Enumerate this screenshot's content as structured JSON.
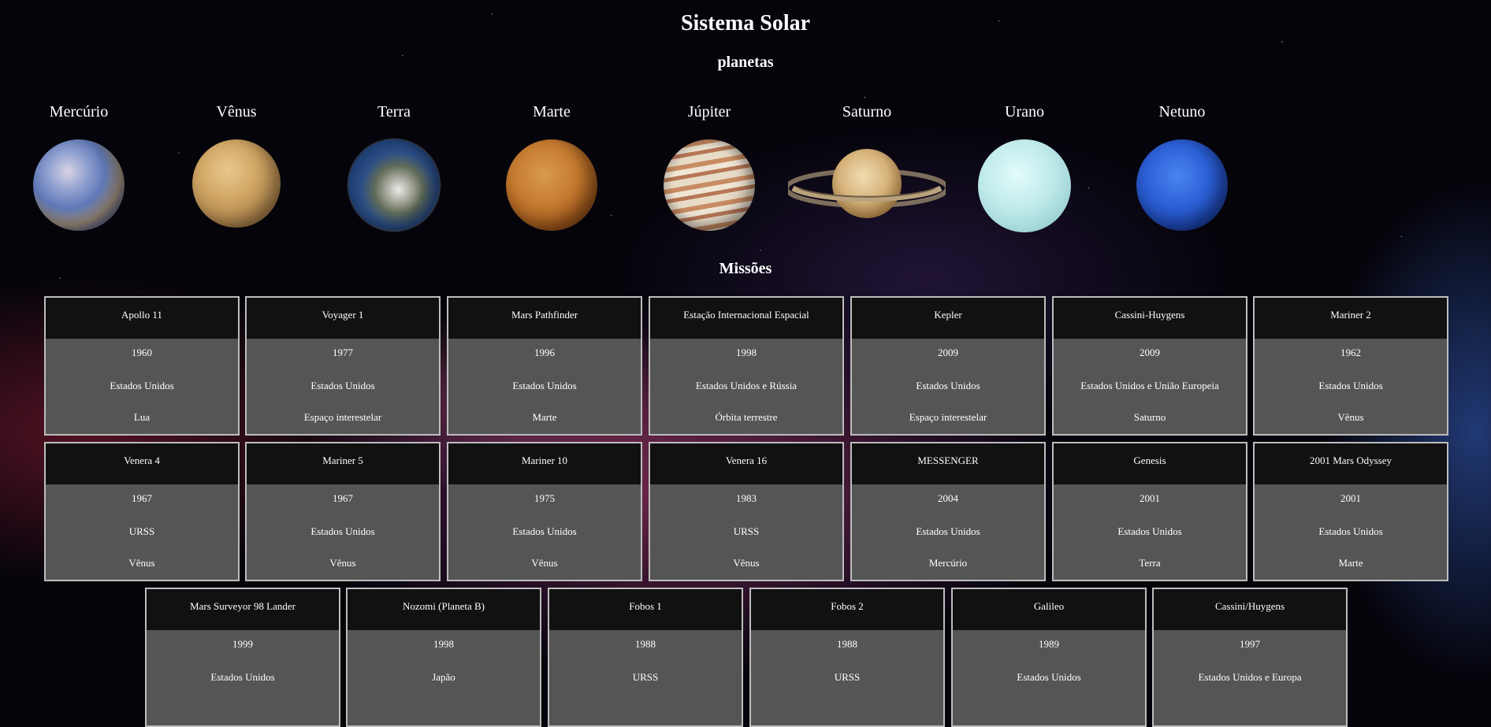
{
  "page": {
    "title": "Sistema Solar",
    "subtitle": "planetas",
    "missions_heading": "Missões"
  },
  "planets": [
    {
      "name": "Mercúrio",
      "icon": "mercury-planet-image"
    },
    {
      "name": "Vênus",
      "icon": "venus-planet-image"
    },
    {
      "name": "Terra",
      "icon": "earth-planet-image"
    },
    {
      "name": "Marte",
      "icon": "mars-planet-image"
    },
    {
      "name": "Júpiter",
      "icon": "jupiter-planet-image"
    },
    {
      "name": "Saturno",
      "icon": "saturn-planet-image"
    },
    {
      "name": "Urano",
      "icon": "uranus-planet-image"
    },
    {
      "name": "Netuno",
      "icon": "neptune-planet-image"
    }
  ],
  "missions": [
    {
      "name": "Apollo 11",
      "year": "1960",
      "country": "Estados Unidos",
      "target": "Lua"
    },
    {
      "name": "Voyager 1",
      "year": "1977",
      "country": "Estados Unidos",
      "target": "Espaço interestelar"
    },
    {
      "name": "Mars Pathfinder",
      "year": "1996",
      "country": "Estados Unidos",
      "target": "Marte"
    },
    {
      "name": "Estação Internacional Espacial",
      "year": "1998",
      "country": "Estados Unidos e Rússia",
      "target": "Órbita terrestre"
    },
    {
      "name": "Kepler",
      "year": "2009",
      "country": "Estados Unidos",
      "target": "Espaço interestelar"
    },
    {
      "name": "Cassini-Huygens",
      "year": "2009",
      "country": "Estados Unidos e União Europeia",
      "target": "Saturno"
    },
    {
      "name": "Mariner 2",
      "year": "1962",
      "country": "Estados Unidos",
      "target": "Vênus"
    },
    {
      "name": "Venera 4",
      "year": "1967",
      "country": "URSS",
      "target": "Vênus"
    },
    {
      "name": "Mariner 5",
      "year": "1967",
      "country": "Estados Unidos",
      "target": "Vênus"
    },
    {
      "name": "Mariner 10",
      "year": "1975",
      "country": "Estados Unidos",
      "target": "Vênus"
    },
    {
      "name": "Venera 16",
      "year": "1983",
      "country": "URSS",
      "target": "Vênus"
    },
    {
      "name": "MESSENGER",
      "year": "2004",
      "country": "Estados Unidos",
      "target": "Mercúrio"
    },
    {
      "name": "Genesis",
      "year": "2001",
      "country": "Estados Unidos",
      "target": "Terra"
    },
    {
      "name": "2001 Mars Odyssey",
      "year": "2001",
      "country": "Estados Unidos",
      "target": "Marte"
    },
    {
      "name": "Mars Surveyor 98 Lander",
      "year": "1999",
      "country": "Estados Unidos",
      "target": ""
    },
    {
      "name": "Nozomi (Planeta B)",
      "year": "1998",
      "country": "Japão",
      "target": ""
    },
    {
      "name": "Fobos 1",
      "year": "1988",
      "country": "URSS",
      "target": ""
    },
    {
      "name": "Fobos 2",
      "year": "1988",
      "country": "URSS",
      "target": ""
    },
    {
      "name": "Galileo",
      "year": "1989",
      "country": "Estados Unidos",
      "target": ""
    },
    {
      "name": "Cassini/Huygens",
      "year": "1997",
      "country": "Estados Unidos e Europa",
      "target": ""
    }
  ]
}
